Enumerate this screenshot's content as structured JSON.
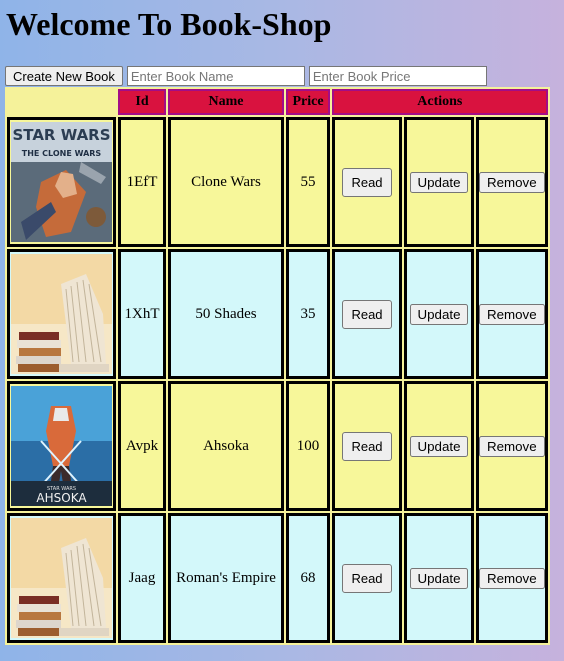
{
  "page": {
    "title": "Welcome To Book-Shop"
  },
  "controls": {
    "create_label": "Create New Book",
    "name_placeholder": "Enter Book Name",
    "price_placeholder": "Enter Book Price"
  },
  "table": {
    "headers": [
      "Id",
      "Name",
      "Price",
      "Actions"
    ],
    "actions": {
      "read": "Read",
      "update": "Update",
      "remove": "Remove"
    },
    "rows": [
      {
        "id": "1EfT",
        "name": "Clone Wars",
        "price": "55",
        "cover": "star-wars-clone-wars-cover",
        "cover_text_top": "STAR WARS",
        "cover_text_bottom": "THE CLONE WARS"
      },
      {
        "id": "1XhT",
        "name": "50 Shades",
        "price": "35",
        "cover": "book-stack-cover"
      },
      {
        "id": "Avpk",
        "name": "Ahsoka",
        "price": "100",
        "cover": "ahsoka-cover",
        "cover_text_top": "STAR WARS",
        "cover_text_bottom": "AHSOKA"
      },
      {
        "id": "Jaag",
        "name": "Roman's Empire",
        "price": "68",
        "cover": "book-stack-cover"
      }
    ]
  },
  "colors": {
    "header_bg": "#d9123f",
    "row_yellow": "#f7f79a",
    "row_cyan": "#d3f8fa"
  }
}
